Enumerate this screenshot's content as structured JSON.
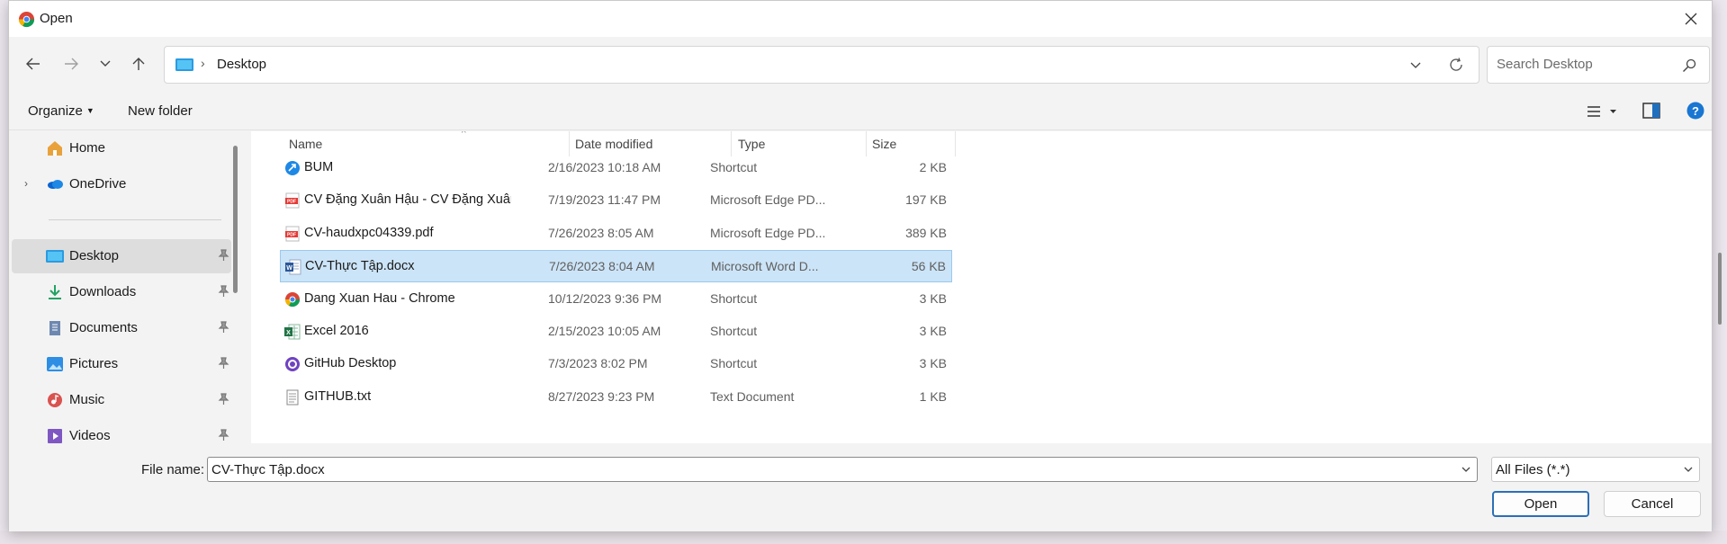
{
  "window": {
    "title": "Open"
  },
  "address": {
    "location": "Desktop",
    "separator": "›"
  },
  "search": {
    "placeholder": "Search Desktop"
  },
  "toolbar": {
    "organize_label": "Organize",
    "new_folder_label": "New folder"
  },
  "nav": {
    "items": [
      {
        "label": "Home",
        "icon": "home-icon"
      },
      {
        "label": "OneDrive",
        "icon": "onedrive-icon",
        "expandable": true
      },
      {
        "label": "Desktop",
        "icon": "desktop-folder-icon",
        "pinned": true,
        "selected": true
      },
      {
        "label": "Downloads",
        "icon": "download-icon",
        "pinned": true
      },
      {
        "label": "Documents",
        "icon": "documents-icon",
        "pinned": true
      },
      {
        "label": "Pictures",
        "icon": "pictures-icon",
        "pinned": true
      },
      {
        "label": "Music",
        "icon": "music-icon",
        "pinned": true
      },
      {
        "label": "Videos",
        "icon": "videos-icon",
        "pinned": true
      }
    ]
  },
  "columns": {
    "name": "Name",
    "date": "Date modified",
    "type": "Type",
    "size": "Size"
  },
  "files": [
    {
      "name": "BUM",
      "date": "2/16/2023 10:18 AM",
      "type": "Shortcut",
      "size": "2 KB",
      "icon": "shortcut-app-icon"
    },
    {
      "name": "CV Đặng Xuân Hậu - CV Đặng Xuân Hậu-...",
      "date": "7/19/2023 11:47 PM",
      "type": "Microsoft Edge PD...",
      "size": "197 KB",
      "icon": "pdf-icon"
    },
    {
      "name": "CV-haudxpc04339.pdf",
      "date": "7/26/2023 8:05 AM",
      "type": "Microsoft Edge PD...",
      "size": "389 KB",
      "icon": "pdf-icon"
    },
    {
      "name": "CV-Thực Tập.docx",
      "date": "7/26/2023 8:04 AM",
      "type": "Microsoft Word D...",
      "size": "56 KB",
      "icon": "word-doc-icon",
      "selected": true
    },
    {
      "name": "Dang Xuan Hau - Chrome",
      "date": "10/12/2023 9:36 PM",
      "type": "Shortcut",
      "size": "3 KB",
      "icon": "chrome-shortcut-icon"
    },
    {
      "name": "Excel 2016",
      "date": "2/15/2023 10:05 AM",
      "type": "Shortcut",
      "size": "3 KB",
      "icon": "excel-icon"
    },
    {
      "name": "GitHub Desktop",
      "date": "7/3/2023 8:02 PM",
      "type": "Shortcut",
      "size": "3 KB",
      "icon": "github-desktop-icon"
    },
    {
      "name": "GITHUB.txt",
      "date": "8/27/2023 9:23 PM",
      "type": "Text Document",
      "size": "1 KB",
      "icon": "text-file-icon"
    }
  ],
  "bottom": {
    "file_name_label": "File name:",
    "file_name_value": "CV-Thực Tập.docx",
    "file_type_value": "All Files (*.*)",
    "open_label": "Open",
    "cancel_label": "Cancel"
  },
  "colors": {
    "accent": "#0067c0",
    "selection": "#cce4f7",
    "selection_border": "#99c9ef"
  }
}
